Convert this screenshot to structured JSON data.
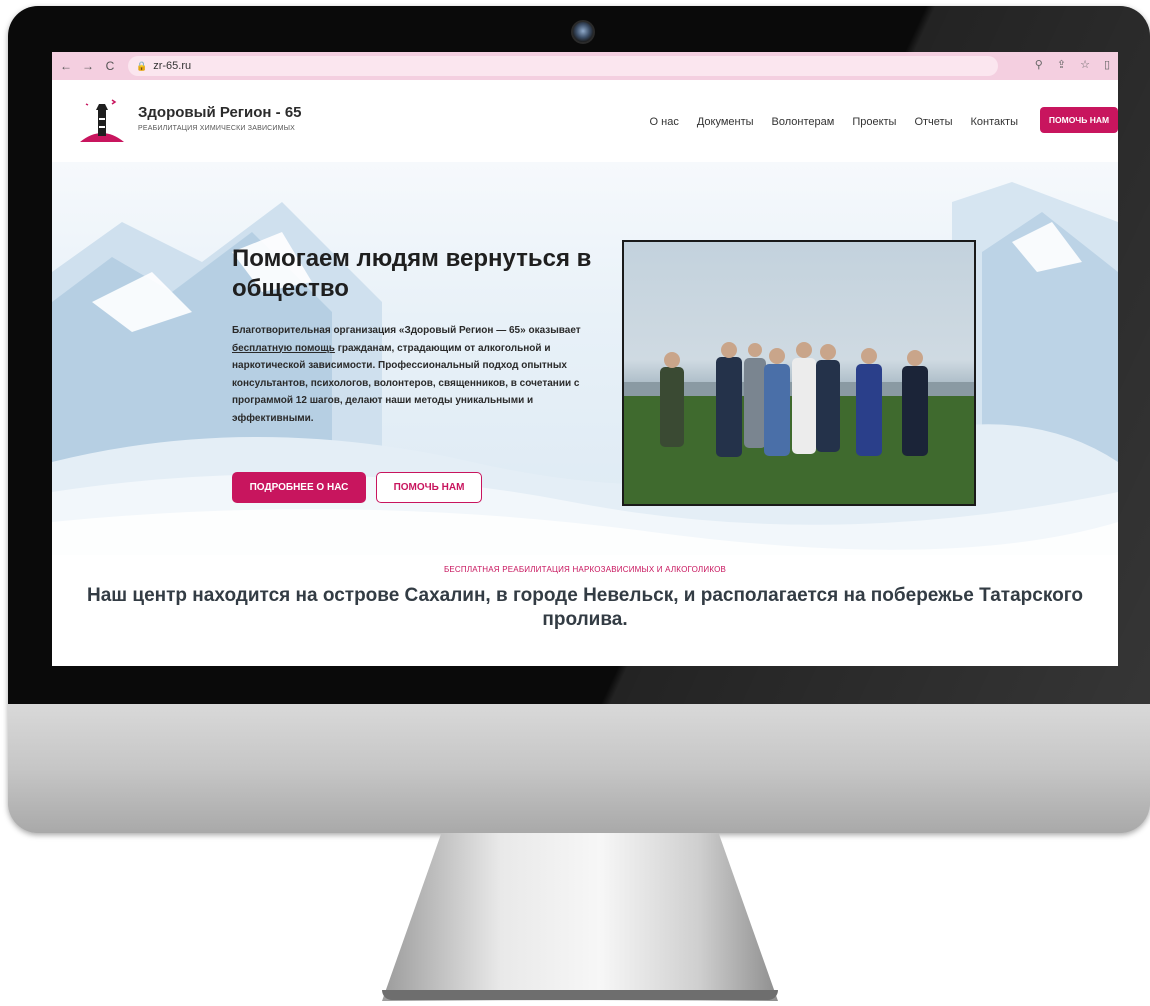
{
  "browser": {
    "url": "zr-65.ru",
    "back_icon": "←",
    "forward_icon": "→",
    "reload_icon": "C"
  },
  "header": {
    "brand_title": "Здоровый Регион - 65",
    "brand_subtitle": "РЕАБИЛИТАЦИЯ ХИМИЧЕСКИ ЗАВИСИМЫХ",
    "menu": [
      "О нас",
      "Документы",
      "Волонтерам",
      "Проекты",
      "Отчеты",
      "Контакты"
    ],
    "cta": "ПОМОЧЬ НАМ"
  },
  "hero": {
    "title": "Помогаем людям вернуться в общество",
    "text_1": "Благотворительная организация «Здоровый Регион — 65» оказывает ",
    "text_link": "бесплатную помощь",
    "text_2": " гражданам, страдающим от алкогольной и наркотической зависимости. Профессиональный подход опытных консультантов, психологов, волонтеров, священников, в сочетании с программой 12 шагов, делают наши методы уникальными и эффективными.",
    "primary_button": "ПОДРОБНЕЕ О НАС",
    "secondary_button": "ПОМОЧЬ НАМ"
  },
  "section": {
    "kicker": "БЕСПЛАТНАЯ РЕАБИЛИТАЦИЯ НАРКОЗАВИСИМЫХ И АЛКОГОЛИКОВ",
    "headline": "Наш центр находится на острове Сахалин, в городе Невельск, и располагается на побережье Татарского пролива."
  },
  "colors": {
    "accent": "#c8155e",
    "browser_bar": "#f4cfe0"
  }
}
